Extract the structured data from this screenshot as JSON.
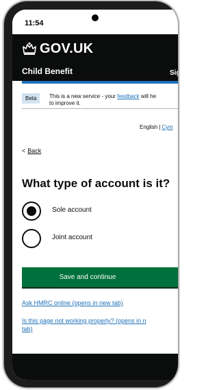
{
  "status_bar": {
    "time": "11:54"
  },
  "header": {
    "logo_text": "GOV.UK",
    "service_name": "Child Benefit",
    "sign_out_label": "Sig"
  },
  "phase_banner": {
    "tag": "Beta",
    "text_before_link": "This is a new service - your ",
    "link_text": "feedback",
    "text_after_link": " will he",
    "text_line2": "to improve it."
  },
  "language_toggle": {
    "current": "English",
    "separator": "|",
    "other": "Cym"
  },
  "back_link": {
    "chevron": "<",
    "label": "Back"
  },
  "question": {
    "heading": "What type of account is it?",
    "options": [
      {
        "label": "Sole account",
        "selected": true
      },
      {
        "label": "Joint account",
        "selected": false
      }
    ]
  },
  "primary_button": {
    "label": "Save and continue"
  },
  "links": {
    "ask_hmrc": "Ask HMRC online (opens in new tab)",
    "not_working_line1": "Is this page not working properly? (opens in n",
    "not_working_line2": "tab)"
  },
  "colors": {
    "header_background": "#0b0c0c",
    "brand_blue": "#1d70b8",
    "button_green": "#00703c",
    "tag_background": "#d2e2f1"
  },
  "icons": [
    "crown-icon",
    "camera-cutout",
    "chevron-left-icon",
    "radio-icon"
  ]
}
